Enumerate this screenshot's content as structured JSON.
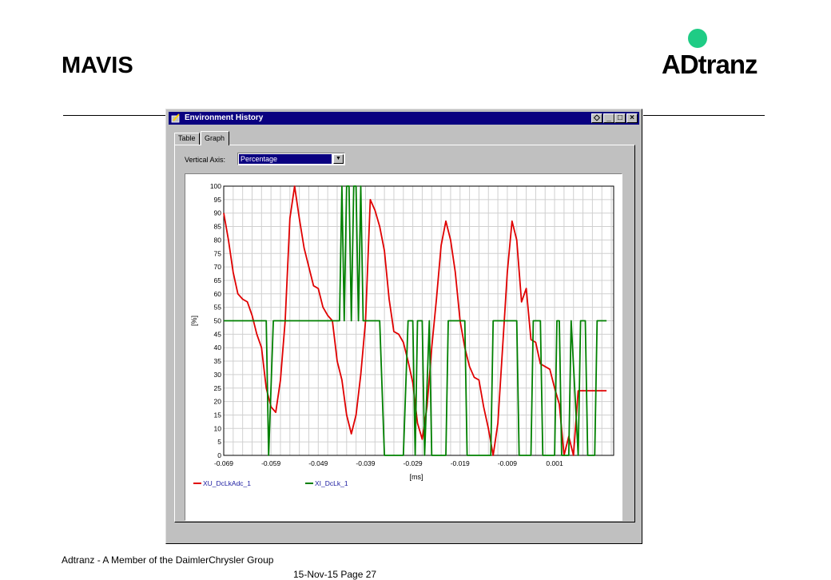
{
  "slide": {
    "title": "MAVIS",
    "logo_text": "ADtranz",
    "footer": "Adtranz - A Member of the DaimlerChrysler Group",
    "page": "15-Nov-15   Page 27"
  },
  "window": {
    "title": "Environment History",
    "controls": [
      "◇",
      "_",
      "□",
      "×"
    ],
    "tabs": [
      {
        "label": "Table",
        "active": false
      },
      {
        "label": "Graph",
        "active": true
      }
    ],
    "vertical_axis_label": "Vertical Axis:",
    "vertical_axis_value": "Percentage"
  },
  "chart_data": {
    "type": "line",
    "xlabel": "[ms]",
    "ylabel": "[%]",
    "xlim": [
      -0.069,
      0.0135
    ],
    "ylim": [
      0,
      100
    ],
    "x_ticks": [
      "-0.069",
      "-0.059",
      "-0.049",
      "-0.039",
      "-0.029",
      "-0.019",
      "-0.009",
      "0.001"
    ],
    "y_ticks": [
      "0",
      "5",
      "10",
      "15",
      "20",
      "25",
      "30",
      "35",
      "40",
      "45",
      "50",
      "55",
      "60",
      "65",
      "70",
      "75",
      "80",
      "85",
      "90",
      "95",
      "100"
    ],
    "grid": true,
    "legend_position": "bottom-left",
    "series": [
      {
        "name": "XU_DcLkAdc_1",
        "color": "#e00000",
        "x": [
          -0.069,
          -0.068,
          -0.067,
          -0.066,
          -0.065,
          -0.064,
          -0.063,
          -0.062,
          -0.061,
          -0.06,
          -0.059,
          -0.058,
          -0.057,
          -0.056,
          -0.055,
          -0.054,
          -0.053,
          -0.052,
          -0.051,
          -0.05,
          -0.049,
          -0.048,
          -0.047,
          -0.046,
          -0.045,
          -0.044,
          -0.043,
          -0.042,
          -0.041,
          -0.04,
          -0.039,
          -0.038,
          -0.037,
          -0.036,
          -0.035,
          -0.034,
          -0.033,
          -0.032,
          -0.031,
          -0.03,
          -0.029,
          -0.028,
          -0.027,
          -0.026,
          -0.025,
          -0.024,
          -0.023,
          -0.022,
          -0.021,
          -0.02,
          -0.019,
          -0.018,
          -0.017,
          -0.016,
          -0.015,
          -0.014,
          -0.013,
          -0.012,
          -0.011,
          -0.01,
          -0.009,
          -0.008,
          -0.007,
          -0.006,
          -0.005,
          -0.004,
          -0.003,
          -0.002,
          -0.001,
          0.0,
          0.001,
          0.002,
          0.003,
          0.004,
          0.005,
          0.006,
          0.007,
          0.008,
          0.009,
          0.01,
          0.011,
          0.012
        ],
        "y": [
          90,
          80,
          68,
          60,
          58,
          57,
          52,
          45,
          40,
          25,
          18,
          16,
          28,
          50,
          88,
          100,
          88,
          77,
          70,
          63,
          62,
          55,
          52,
          50,
          35,
          28,
          15,
          8,
          15,
          30,
          50,
          95,
          91,
          85,
          76,
          58,
          46,
          45,
          42,
          35,
          27,
          12,
          6,
          18,
          40,
          58,
          78,
          87,
          80,
          68,
          50,
          40,
          33,
          29,
          28,
          18,
          10,
          0,
          12,
          40,
          68,
          87,
          80,
          57,
          62,
          43,
          42,
          34,
          33,
          32,
          25,
          19,
          0,
          7,
          0,
          24,
          24,
          24,
          24,
          24,
          24,
          24
        ]
      },
      {
        "name": "XI_DcLk_1",
        "color": "#008000",
        "x": [
          -0.069,
          -0.06,
          -0.0595,
          -0.0585,
          -0.058,
          -0.0445,
          -0.044,
          -0.0435,
          -0.043,
          -0.0425,
          -0.042,
          -0.0415,
          -0.041,
          -0.0405,
          -0.04,
          -0.0395,
          -0.036,
          -0.035,
          -0.0345,
          -0.031,
          -0.03,
          -0.029,
          -0.0285,
          -0.028,
          -0.027,
          -0.0265,
          -0.0255,
          -0.025,
          -0.022,
          -0.0215,
          -0.018,
          -0.0175,
          -0.0125,
          -0.012,
          -0.007,
          -0.0065,
          -0.004,
          -0.0035,
          -0.002,
          -0.0015,
          0.001,
          0.0015,
          0.002,
          0.0025,
          0.004,
          0.0045,
          0.006,
          0.0065,
          0.0075,
          0.008,
          0.0095,
          0.01,
          0.0115,
          0.012
        ],
        "y": [
          50,
          50,
          0,
          50,
          50,
          50,
          100,
          50,
          100,
          100,
          50,
          100,
          100,
          50,
          100,
          50,
          50,
          0,
          0,
          0,
          50,
          50,
          0,
          50,
          50,
          0,
          50,
          0,
          0,
          50,
          50,
          0,
          0,
          50,
          50,
          0,
          0,
          50,
          50,
          0,
          0,
          50,
          50,
          0,
          0,
          50,
          0,
          50,
          50,
          0,
          0,
          50,
          50,
          50
        ]
      }
    ]
  }
}
